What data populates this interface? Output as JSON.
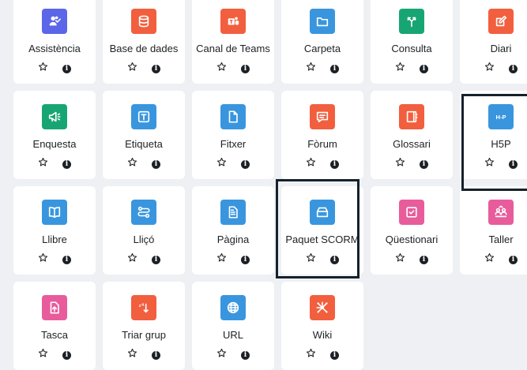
{
  "colors": {
    "purple": "#5b67e8",
    "red": "#f25f3e",
    "green": "#17a673",
    "blue": "#3996de",
    "pink": "#e85c9c"
  },
  "activities": [
    {
      "label": "Assistència",
      "color": "#5b67e8",
      "icon": "attendance-icon"
    },
    {
      "label": "Base de dades",
      "color": "#f25f3e",
      "icon": "database-icon"
    },
    {
      "label": "Canal de Teams",
      "color": "#f25f3e",
      "icon": "teams-icon"
    },
    {
      "label": "Carpeta",
      "color": "#3996de",
      "icon": "folder-icon"
    },
    {
      "label": "Consulta",
      "color": "#17a673",
      "icon": "choice-icon"
    },
    {
      "label": "Diari",
      "color": "#f25f3e",
      "icon": "journal-icon"
    },
    {
      "label": "Enquesta",
      "color": "#17a673",
      "icon": "megaphone-icon"
    },
    {
      "label": "Etiqueta",
      "color": "#3996de",
      "icon": "label-icon"
    },
    {
      "label": "Fitxer",
      "color": "#3996de",
      "icon": "file-icon"
    },
    {
      "label": "Fòrum",
      "color": "#f25f3e",
      "icon": "forum-icon"
    },
    {
      "label": "Glossari",
      "color": "#f25f3e",
      "icon": "glossary-icon"
    },
    {
      "label": "H5P",
      "color": "#3996de",
      "icon": "h5p-icon",
      "logo_text": "H-P"
    },
    {
      "label": "Llibre",
      "color": "#3996de",
      "icon": "book-icon"
    },
    {
      "label": "Lliçó",
      "color": "#3996de",
      "icon": "lesson-icon"
    },
    {
      "label": "Pàgina",
      "color": "#3996de",
      "icon": "page-icon"
    },
    {
      "label": "Paquet SCORM",
      "color": "#3996de",
      "icon": "scorm-package-icon"
    },
    {
      "label": "Qüestionari",
      "color": "#e85c9c",
      "icon": "quiz-icon"
    },
    {
      "label": "Taller",
      "color": "#e85c9c",
      "icon": "workshop-icon"
    },
    {
      "label": "Tasca",
      "color": "#e85c9c",
      "icon": "assignment-icon"
    },
    {
      "label": "Triar grup",
      "color": "#f25f3e",
      "icon": "group-choice-icon"
    },
    {
      "label": "URL",
      "color": "#3996de",
      "icon": "globe-icon"
    },
    {
      "label": "Wiki",
      "color": "#f25f3e",
      "icon": "wiki-icon"
    }
  ],
  "info_glyph": "i"
}
